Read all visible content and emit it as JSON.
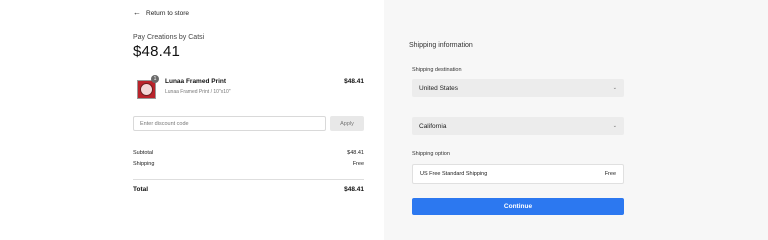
{
  "nav": {
    "return_label": "Return to store"
  },
  "order": {
    "merchant": "Pay Creations by Catsi",
    "amount": "$48.41",
    "item": {
      "name": "Lunaa Framed Print",
      "variant": "Lunaa Framed Print / 10\"x10\"",
      "price": "$48.41",
      "quantity": "1"
    },
    "discount": {
      "placeholder": "Enter discount code",
      "apply_label": "Apply"
    },
    "summary": {
      "subtotal_label": "Subtotal",
      "subtotal_value": "$48.41",
      "shipping_label": "Shipping",
      "shipping_value": "Free",
      "total_label": "Total",
      "total_value": "$48.41"
    }
  },
  "shipping": {
    "title": "Shipping information",
    "destination_label": "Shipping destination",
    "country": "United States",
    "state": "California",
    "option_label": "Shipping option",
    "option_name": "US Free Standard Shipping",
    "option_price": "Free",
    "continue_label": "Continue"
  },
  "colors": {
    "primary_button": "#2c78f0",
    "panel_bg": "#f7f7f7"
  }
}
